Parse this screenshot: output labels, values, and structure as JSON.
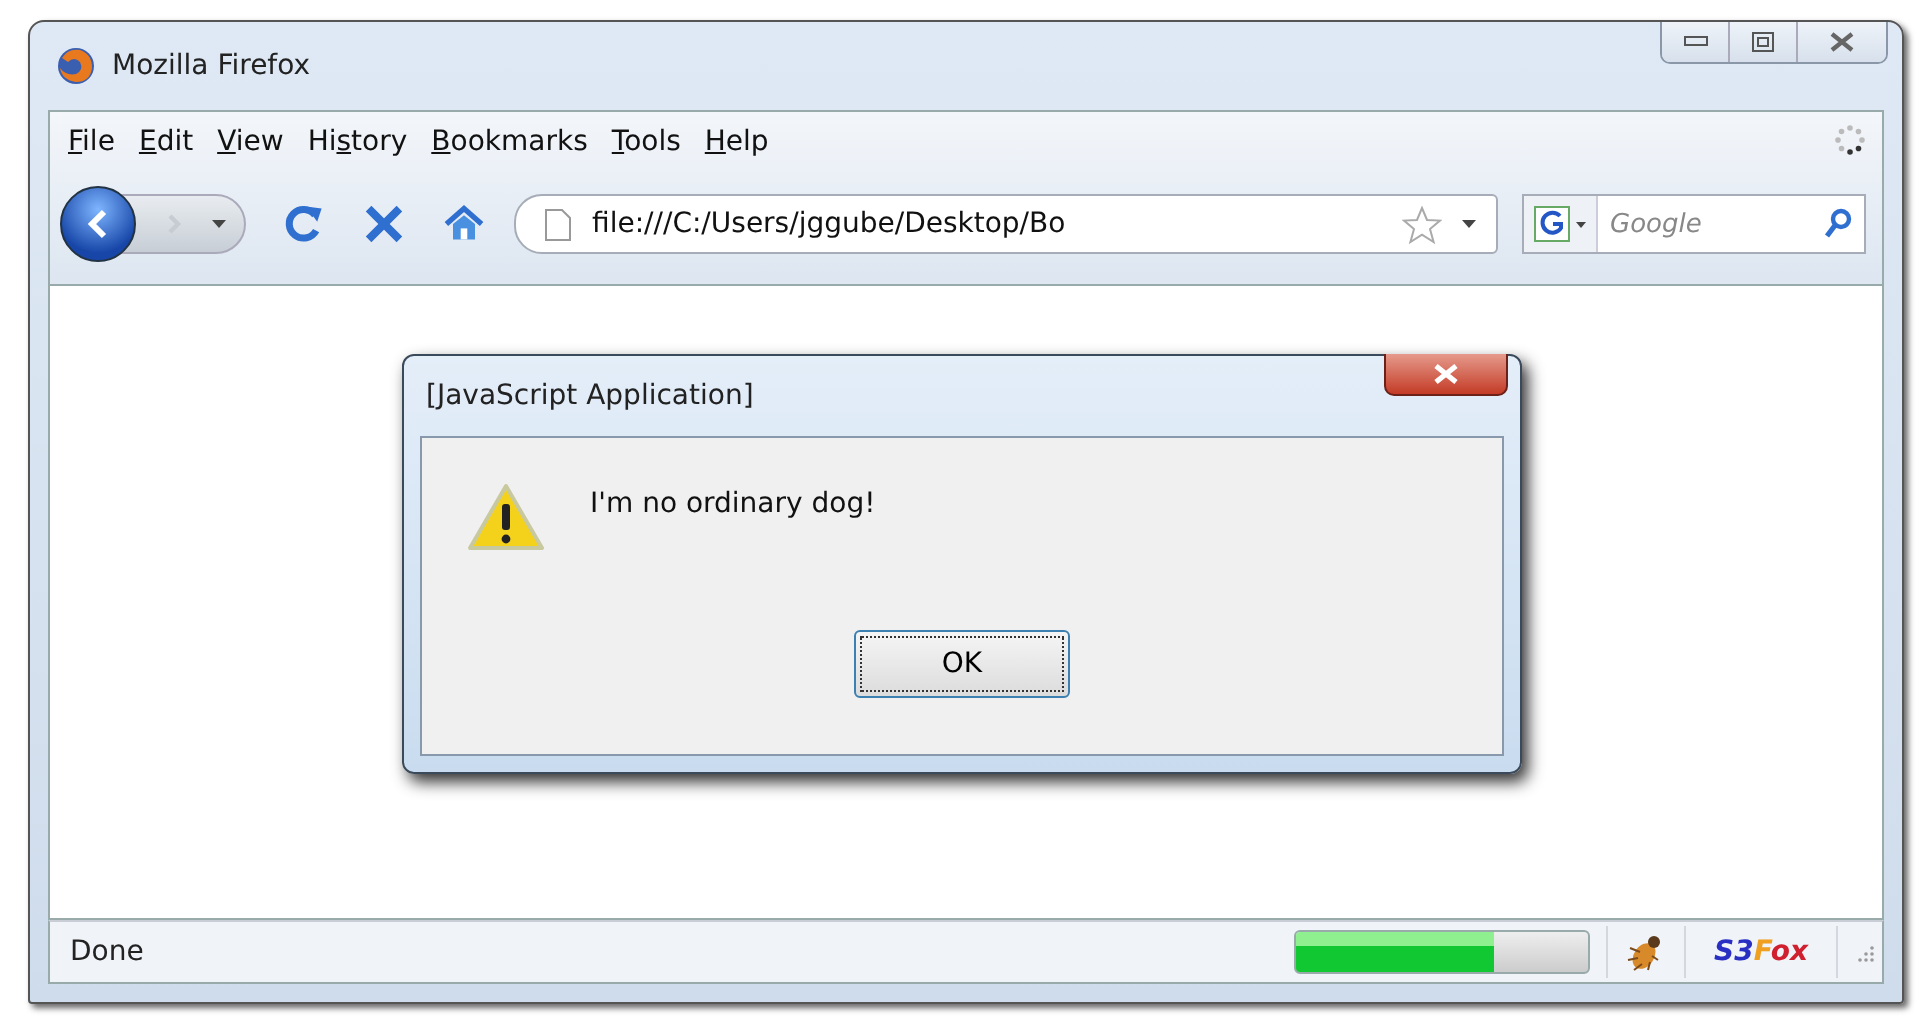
{
  "window": {
    "title": "Mozilla Firefox"
  },
  "menu": [
    {
      "accel": "F",
      "rest": "ile"
    },
    {
      "accel": "E",
      "rest": "dit"
    },
    {
      "accel": "V",
      "rest": "iew"
    },
    {
      "pre": "Hi",
      "accel": "s",
      "rest": "tory"
    },
    {
      "accel": "B",
      "rest": "ookmarks"
    },
    {
      "accel": "T",
      "rest": "ools"
    },
    {
      "accel": "H",
      "rest": "elp"
    }
  ],
  "address": {
    "value": "file:///C:/Users/jggube/Desktop/Bo"
  },
  "search": {
    "placeholder": "Google"
  },
  "dialog": {
    "title": "[JavaScript Application]",
    "message": "I'm no ordinary dog!",
    "button": "OK"
  },
  "status_bar": {
    "text": "Done",
    "progress": {
      "level": 0.68
    },
    "addon": [
      {
        "text": "S3",
        "color": "#2a2fc4"
      },
      {
        "text": "F",
        "color": "#f0a020"
      },
      {
        "text": "ox",
        "color": "#d02030"
      }
    ]
  }
}
